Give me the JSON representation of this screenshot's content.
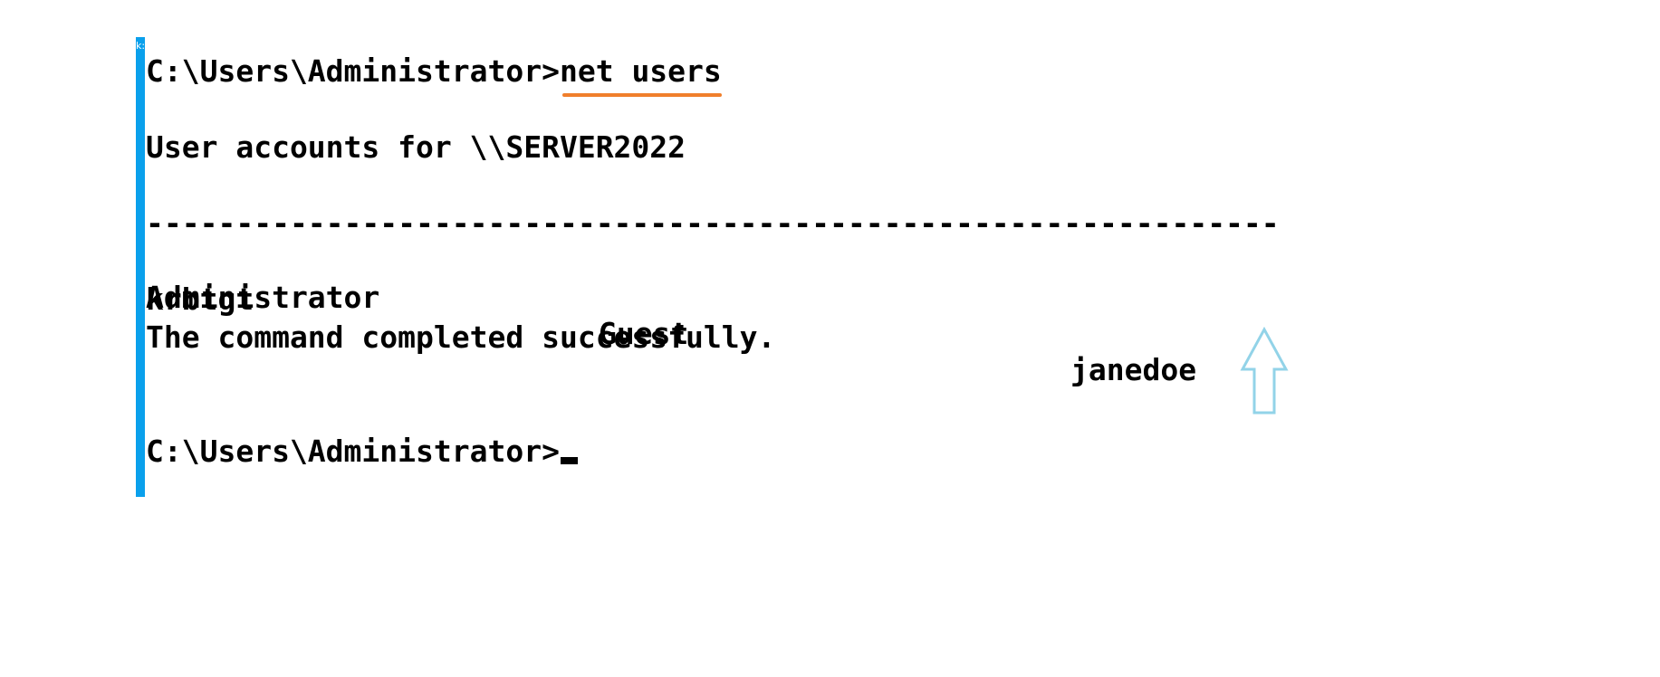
{
  "window": {
    "edge_label": "k:"
  },
  "terminal": {
    "prompt_1": "C:\\Users\\Administrator>",
    "command": "net users",
    "accounts_header": "User accounts for \\\\SERVER2022",
    "separator": "-------------------------------------------------------------------------------",
    "users": [
      "Administrator",
      "Guest",
      "janedoe",
      "krbtgt"
    ],
    "status": "The command completed successfully.",
    "prompt_2": "C:\\Users\\Administrator>"
  },
  "annotations": {
    "underline_color": "#f07f2c",
    "arrow_color": "#92d3e8",
    "arrow_icon": "up-arrow-icon"
  }
}
